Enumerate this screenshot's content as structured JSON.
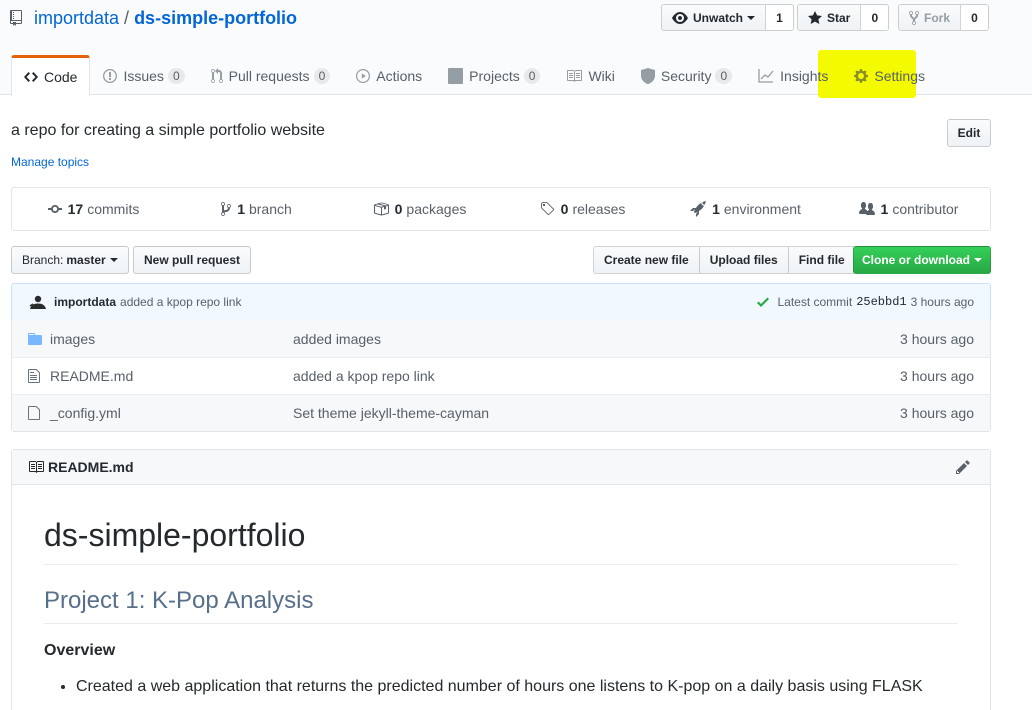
{
  "repo": {
    "owner": "importdata",
    "separator": "/",
    "name": "ds-simple-portfolio"
  },
  "actions": {
    "watch": {
      "label": "Unwatch",
      "count": "1"
    },
    "star": {
      "label": "Star",
      "count": "0"
    },
    "fork": {
      "label": "Fork",
      "count": "0"
    }
  },
  "tabs": [
    {
      "label": "Code",
      "count": null,
      "icon": "code-icon"
    },
    {
      "label": "Issues",
      "count": "0",
      "icon": "issue-icon"
    },
    {
      "label": "Pull requests",
      "count": "0",
      "icon": "pull-request-icon"
    },
    {
      "label": "Actions",
      "count": null,
      "icon": "play-icon"
    },
    {
      "label": "Projects",
      "count": "0",
      "icon": "project-icon"
    },
    {
      "label": "Wiki",
      "count": null,
      "icon": "book-icon"
    },
    {
      "label": "Security",
      "count": "0",
      "icon": "shield-icon"
    },
    {
      "label": "Insights",
      "count": null,
      "icon": "graph-icon"
    },
    {
      "label": "Settings",
      "count": null,
      "icon": "gear-icon"
    }
  ],
  "about": {
    "description": "a repo for creating a simple portfolio website",
    "topics_link": "Manage topics",
    "edit_label": "Edit"
  },
  "summary": [
    {
      "num": "17",
      "label": "commits",
      "icon": "commit-icon"
    },
    {
      "num": "1",
      "label": "branch",
      "icon": "branch-icon"
    },
    {
      "num": "0",
      "label": "packages",
      "icon": "package-icon"
    },
    {
      "num": "0",
      "label": "releases",
      "icon": "tag-icon"
    },
    {
      "num": "1",
      "label": "environment",
      "icon": "rocket-icon"
    },
    {
      "num": "1",
      "label": "contributor",
      "icon": "people-icon"
    }
  ],
  "file_nav": {
    "branch_prefix": "Branch:",
    "branch_name": "master",
    "new_pr": "New pull request",
    "create_file": "Create new file",
    "upload_files": "Upload files",
    "find_file": "Find file",
    "clone": "Clone or download"
  },
  "commit": {
    "author": "importdata",
    "message": "added a kpop repo link",
    "latest_label": "Latest commit",
    "sha": "25ebbd1",
    "age": "3 hours ago"
  },
  "files": [
    {
      "name": "images",
      "message": "added images",
      "age": "3 hours ago",
      "type": "dir"
    },
    {
      "name": "README.md",
      "message": "added a kpop repo link",
      "age": "3 hours ago",
      "type": "file"
    },
    {
      "name": "_config.yml",
      "message": "Set theme jekyll-theme-cayman",
      "age": "3 hours ago",
      "type": "file"
    }
  ],
  "readme": {
    "file_label": "README.md",
    "h1": "ds-simple-portfolio",
    "h2": "Project 1: K-Pop Analysis",
    "h3": "Overview",
    "bullet1": "Created a web application that returns the predicted number of hours one listens to K-pop on a daily basis using FLASK"
  },
  "colors": {
    "link": "#0366d6",
    "tab_accent": "#e36209",
    "clone_green": "#28a745",
    "highlight": "#f4fb00"
  }
}
